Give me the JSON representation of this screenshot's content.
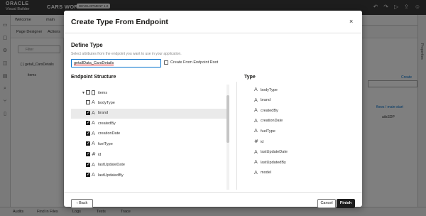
{
  "app": {
    "logo_line1": "ORACLE",
    "logo_line2": "Visual Builder",
    "name": "CARS WORLD",
    "env_badge": "DEVELOPMENT 1.0",
    "top_icons": [
      "undo-icon",
      "redo-icon",
      "play-icon",
      "share-icon",
      "user-icon"
    ]
  },
  "tabs": {
    "welcome": "Welcome",
    "main": "main"
  },
  "subtabs": {
    "page_designer": "Page Designer",
    "actions": "Actions"
  },
  "left_panel": {
    "filter_placeholder": "Filter",
    "endpoint": "{ } getall_CarsDetails",
    "items": "items"
  },
  "right_panel": {
    "create": "Create",
    "breadcrumb": "flows / main-start",
    "variable": "ailsSDP",
    "properties": "Properties"
  },
  "bottombar": {
    "audits": "Audits",
    "find": "Find in Files",
    "logs": "Logs",
    "tests": "Tests",
    "trace": "Trace"
  },
  "dialog": {
    "title": "Create Type From Endpoint",
    "close": "×",
    "section_title": "Define Type",
    "section_desc": "Select attributes from the endpoint you want to use in your application.",
    "type_name_value": "getallData_CarsDetails",
    "root_checkbox_label": "Create From Endpoint Root",
    "endpoint_structure_heading": "Endpoint Structure",
    "type_heading": "Type",
    "tree_root": "items",
    "tree_items": [
      {
        "label": "bodyType",
        "icon": "A",
        "checked": false
      },
      {
        "label": "brand",
        "icon": "A",
        "checked": true
      },
      {
        "label": "createdBy",
        "icon": "A",
        "checked": true
      },
      {
        "label": "creationDate",
        "icon": "A",
        "checked": true
      },
      {
        "label": "fuelType",
        "icon": "A",
        "checked": true
      },
      {
        "label": "id",
        "icon": "#",
        "checked": true
      },
      {
        "label": "lastUpdateDate",
        "icon": "A",
        "checked": true
      },
      {
        "label": "lastUpdatedBy",
        "icon": "A",
        "checked": true
      }
    ],
    "type_items": [
      {
        "label": "bodyType",
        "icon": "A"
      },
      {
        "label": "brand",
        "icon": "A"
      },
      {
        "label": "createdBy",
        "icon": "A"
      },
      {
        "label": "creationDate",
        "icon": "A"
      },
      {
        "label": "fuelType",
        "icon": "A"
      },
      {
        "label": "id",
        "icon": "#"
      },
      {
        "label": "lastUpdateDate",
        "icon": "A"
      },
      {
        "label": "lastUpdatedBy",
        "icon": "A"
      },
      {
        "label": "model",
        "icon": "A"
      }
    ],
    "back_label": "Back",
    "cancel_label": "Cancel",
    "finish_label": "Finish"
  }
}
